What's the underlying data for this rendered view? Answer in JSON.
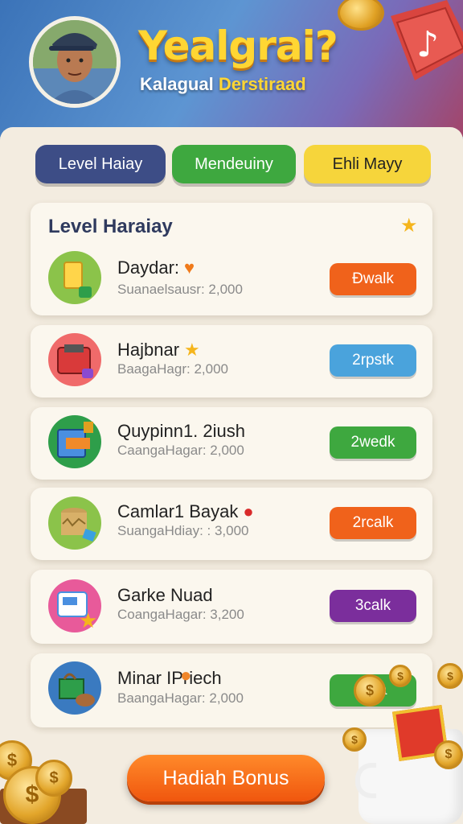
{
  "header": {
    "title": "Yealgrai?",
    "subtitle_main": "Kalagual ",
    "subtitle_highlight": "Derstiraad"
  },
  "tabs": [
    {
      "label": "Level Haiay"
    },
    {
      "label": "Mendeuiny"
    },
    {
      "label": "Ehli Mayy"
    }
  ],
  "section": {
    "title": "Level Haraiay"
  },
  "items": [
    {
      "name": "Daydar:",
      "sub": "Suanaelsausr: 2,000",
      "badge": "Đwalk",
      "badge_color": "#f0621b"
    },
    {
      "name": "Hajbnar",
      "sub": "BaagaHagr: 2,000",
      "badge": "2rpstk",
      "badge_color": "#4aa3dc"
    },
    {
      "name": "Quypinn1. 2iush",
      "sub": "CaangaHagar: 2,000",
      "badge": "2wedk",
      "badge_color": "#3ea83f"
    },
    {
      "name": "Camlar1 Bayak",
      "sub": "SuangaHdiay: : 3,000",
      "badge": "2rcalk",
      "badge_color": "#f0621b"
    },
    {
      "name": "Garke Nuad",
      "sub": "CoangaHagar: 3,200",
      "badge": "3calk",
      "badge_color": "#7b2e9c"
    },
    {
      "name": "Minar  IPriech",
      "sub": "BaangaHagar: 2,000",
      "badge": "Una",
      "badge_color": "#3ea83f"
    }
  ],
  "bonus_button": "Hadiah Bonus",
  "colors": {
    "accent_orange": "#f0621b",
    "accent_blue": "#3d4d86",
    "accent_yellow": "#f6d53b"
  }
}
